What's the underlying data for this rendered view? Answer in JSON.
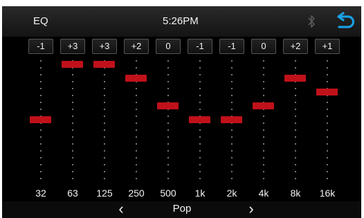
{
  "header": {
    "title": "EQ",
    "time": "5:26PM",
    "bluetooth_icon": "bluetooth-icon",
    "back_icon": "back-icon",
    "bluetooth_color": "#5a5a5a",
    "back_color": "#1aa0e6"
  },
  "eq": {
    "range": [
      -3,
      3
    ],
    "handle_color": "#c0111a",
    "bands": [
      {
        "freq": "32",
        "gain": "-1",
        "value": -1
      },
      {
        "freq": "63",
        "gain": "+3",
        "value": 3
      },
      {
        "freq": "125",
        "gain": "+3",
        "value": 3
      },
      {
        "freq": "250",
        "gain": "+2",
        "value": 2
      },
      {
        "freq": "500",
        "gain": "0",
        "value": 0
      },
      {
        "freq": "1k",
        "gain": "-1",
        "value": -1
      },
      {
        "freq": "2k",
        "gain": "-1",
        "value": -1
      },
      {
        "freq": "4k",
        "gain": "0",
        "value": 0
      },
      {
        "freq": "8k",
        "gain": "+2",
        "value": 2
      },
      {
        "freq": "16k",
        "gain": "+1",
        "value": 1
      }
    ]
  },
  "preset": {
    "name": "Pop",
    "prev_glyph": "‹",
    "next_glyph": "›"
  }
}
